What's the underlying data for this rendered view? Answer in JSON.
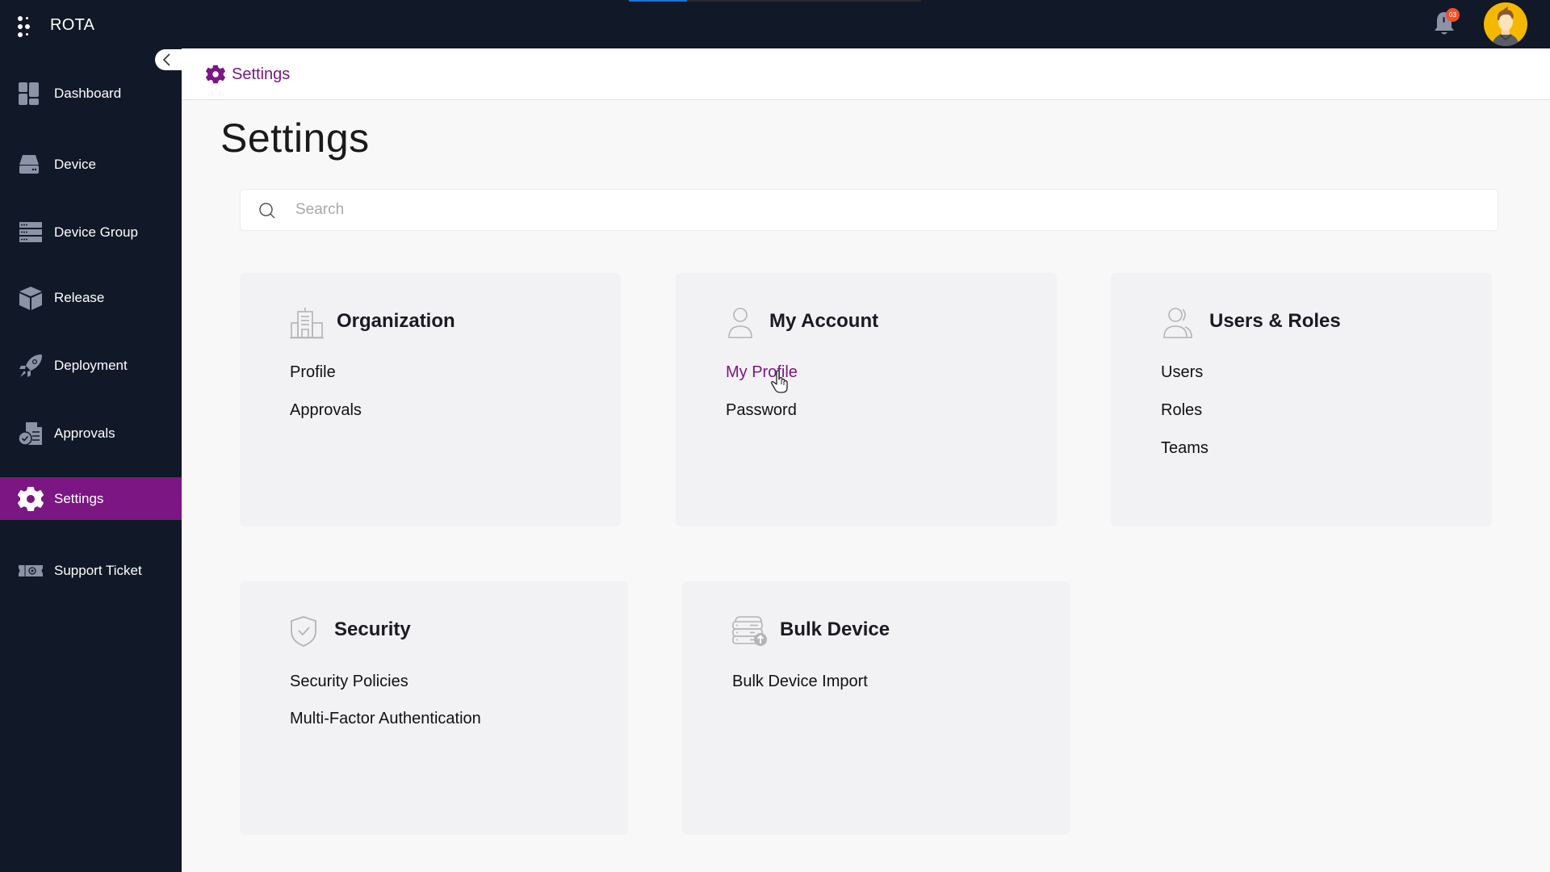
{
  "app": {
    "brand": "ROTA",
    "loading_progress": 0.2,
    "notifications_count": "03"
  },
  "colors": {
    "sidebar_bg": "#111827",
    "accent": "#7b1682",
    "card_bg": "#f2f2f5",
    "badge": "#f0512b",
    "progress": "#1a73d9"
  },
  "sidebar": {
    "items": [
      {
        "label": "Dashboard",
        "icon": "dashboard-icon"
      },
      {
        "label": "Device",
        "icon": "device-icon"
      },
      {
        "label": "Device Group",
        "icon": "device-group-icon"
      },
      {
        "label": "Release",
        "icon": "release-icon"
      },
      {
        "label": "Deployment",
        "icon": "rocket-icon"
      },
      {
        "label": "Approvals",
        "icon": "approvals-icon"
      },
      {
        "label": "Settings",
        "icon": "gear-icon",
        "active": true
      },
      {
        "label": "Support Ticket",
        "icon": "ticket-icon"
      }
    ]
  },
  "header": {
    "breadcrumb": "Settings"
  },
  "main": {
    "title": "Settings",
    "search": {
      "placeholder": "Search",
      "value": ""
    },
    "cards": [
      {
        "title": "Organization",
        "icon": "building-icon",
        "links": [
          "Profile",
          "Approvals"
        ]
      },
      {
        "title": "My Account",
        "icon": "user-icon",
        "links": [
          "My Profile",
          "Password"
        ],
        "hovered_link": "My Profile"
      },
      {
        "title": "Users & Roles",
        "icon": "users-icon",
        "links": [
          "Users",
          "Roles",
          "Teams"
        ]
      },
      {
        "title": "Security",
        "icon": "shield-icon",
        "links": [
          "Security Policies",
          "Multi-Factor Authentication"
        ]
      },
      {
        "title": "Bulk Device",
        "icon": "bulk-device-icon",
        "links": [
          "Bulk Device Import"
        ]
      }
    ]
  }
}
